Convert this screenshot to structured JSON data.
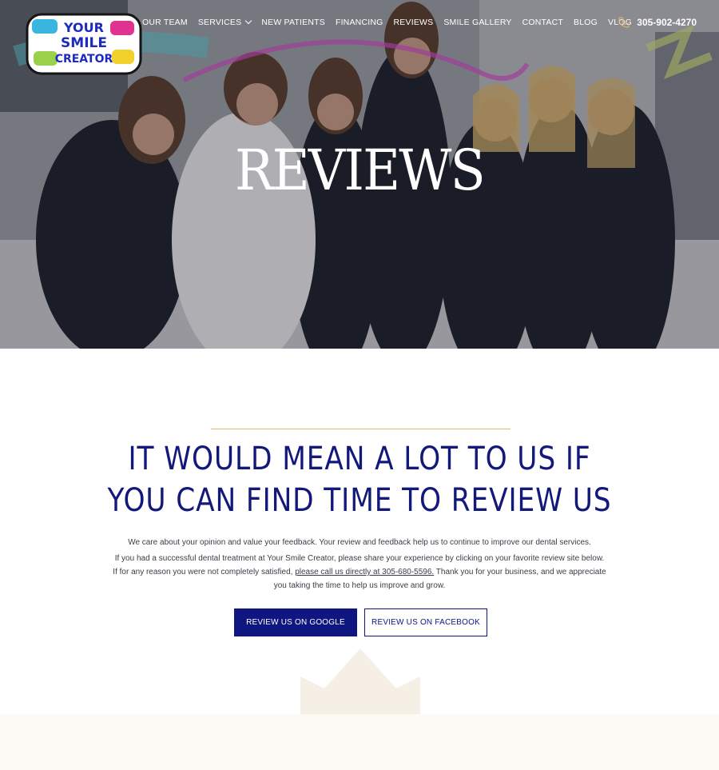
{
  "brand": {
    "logo_lines": [
      "YOUR",
      "SMILE",
      "CREATOR"
    ]
  },
  "nav": {
    "items": [
      {
        "label": "OUR TEAM"
      },
      {
        "label": "SERVICES"
      },
      {
        "label": "NEW PATIENTS"
      },
      {
        "label": "FINANCING"
      },
      {
        "label": "REVIEWS"
      },
      {
        "label": "SMILE GALLERY"
      },
      {
        "label": "CONTACT"
      },
      {
        "label": "BLOG"
      },
      {
        "label": "VLOG"
      }
    ],
    "phone": "305-902-4270"
  },
  "hero": {
    "title": "REVIEWS"
  },
  "main": {
    "headline_line1": "IT WOULD MEAN A LOT TO US IF",
    "headline_line2": "YOU CAN FIND TIME TO REVIEW US",
    "paragraph1": "We care about your opinion and value your feedback. Your review and feedback help us to continue to improve our dental services.",
    "paragraph2_before": "If you had a successful dental treatment at Your Smile Creator, please share your experience by clicking on your favorite review site below. If for any reason you were not completely satisfied, ",
    "paragraph2_link": "please call us directly at 305-680-5596.",
    "paragraph2_after": " Thank you for your business, and we appreciate you taking the time to help us improve and grow.",
    "button_google": "REVIEW US ON GOOGLE",
    "button_facebook": "REVIEW US ON FACEBOOK"
  },
  "colors": {
    "navy": "#0f1680",
    "gold_rule": "#e3b877",
    "headline": "#13197a",
    "cream_band": "#fdf9f4"
  },
  "icons": {
    "phone": "phone-icon",
    "chevron": "chevron-down-icon"
  }
}
